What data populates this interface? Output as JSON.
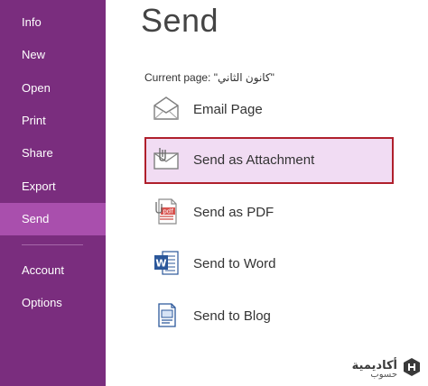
{
  "sidebar": {
    "items": [
      {
        "label": "Info"
      },
      {
        "label": "New"
      },
      {
        "label": "Open"
      },
      {
        "label": "Print"
      },
      {
        "label": "Share"
      },
      {
        "label": "Export"
      },
      {
        "label": "Send",
        "active": true
      },
      {
        "label": "Account"
      },
      {
        "label": "Options"
      }
    ],
    "bg_color": "#7a2d7e",
    "active_color": "#a94fad"
  },
  "main": {
    "title": "Send",
    "current_page": "Current page: \"كانون الثاني\"",
    "options": [
      {
        "label": "Email Page",
        "icon": "envelope-icon"
      },
      {
        "label": "Send as Attachment",
        "icon": "attachment-envelope-icon",
        "selected": true
      },
      {
        "label": "Send as PDF",
        "icon": "pdf-file-icon"
      },
      {
        "label": "Send to Word",
        "icon": "word-icon"
      },
      {
        "label": "Send to Blog",
        "icon": "blog-icon"
      }
    ],
    "selected_bg": "#f1dcf3",
    "selected_border": "#b0202c"
  },
  "watermark": {
    "main": "أكاديمية",
    "sub": "حسوب"
  }
}
